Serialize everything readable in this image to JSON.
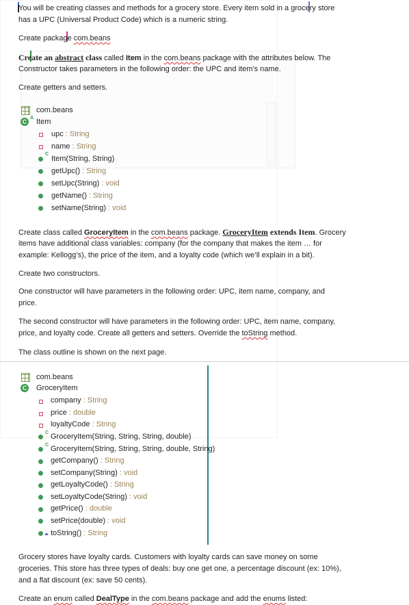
{
  "p1": {
    "l1": "You will be creating classes and methods for a grocery store. Every item sold in a grocery store",
    "l2": "has a UPC (Universal Product Code) which is a numeric string."
  },
  "p2": {
    "a": "Create package ",
    "b": "com.beans"
  },
  "p3": {
    "a": "Create an ",
    "b": "abstract",
    "c": " class",
    "d": " called ",
    "e": "Item",
    "f": " in the ",
    "g": "com.beans",
    "h": " package with the attributes below. The",
    "l2": "Constructor takes parameters in the following order: the UPC and item’s name."
  },
  "p4": "Create getters and setters.",
  "tree1": {
    "package": "com.beans",
    "class": "Item",
    "class_modifier": "A",
    "fields": [
      {
        "name": "upc",
        "type": " : String"
      },
      {
        "name": "name",
        "type": " : String"
      }
    ],
    "methods": [
      {
        "name": "Item(String, String)",
        "type": "",
        "badge": "C"
      },
      {
        "name": "getUpc()",
        "type": " : String"
      },
      {
        "name": "setUpc(String)",
        "type": " : void"
      },
      {
        "name": "getName()",
        "type": " : String"
      },
      {
        "name": "setName(String)",
        "type": " : void"
      }
    ]
  },
  "p5": {
    "a": "Create class called ",
    "b": "GroceryItem",
    "c": " in the ",
    "d": "com.beans",
    "e": " package. ",
    "f": "GroceryItem",
    "g": " extends Item",
    "h": ". Grocery",
    "l2": "items have additional class variables: company (for the company that makes the item … for",
    "l3": "example: Kellogg’s), the price of the item, and a loyalty code (which we’ll explain in a bit)."
  },
  "p6": "Create two constructors.",
  "p7": {
    "l1": "One constructor will have parameters in the following order: UPC, item name, company, and",
    "l2": "price."
  },
  "p8": {
    "l1": "The second constructor will have parameters in the following order:  UPC, item name, company,",
    "l2a": "price, and loyalty code. Create all getters and setters. Override the ",
    "l2b": "toString",
    "l2c": " method."
  },
  "p9": "The class outline is shown on the next page.",
  "tree2": {
    "package": "com.beans",
    "class": "GroceryItem",
    "fields": [
      {
        "name": "company",
        "type": " : String"
      },
      {
        "name": "price",
        "type": " : double"
      },
      {
        "name": "loyaltyCode",
        "type": " : String"
      }
    ],
    "methods": [
      {
        "name": "GroceryItem(String, String, String, double)",
        "type": "",
        "badge": "C"
      },
      {
        "name": "GroceryItem(String, String, String, double, String)",
        "type": "",
        "badge": "C"
      },
      {
        "name": "getCompany()",
        "type": " : String"
      },
      {
        "name": "setCompany(String)",
        "type": " : void"
      },
      {
        "name": "getLoyaltyCode()",
        "type": " : String"
      },
      {
        "name": "setLoyaltyCode(String)",
        "type": " : void"
      },
      {
        "name": "getPrice()",
        "type": " : double"
      },
      {
        "name": "setPrice(double)",
        "type": " : void"
      },
      {
        "name": "toString()",
        "type": " : String",
        "badge": "override"
      }
    ]
  },
  "p10": {
    "l1": "Grocery stores have loyalty cards. Customers with loyalty cards can save money on some",
    "l2": "groceries. This store has three types of deals: buy one get one, a percentage discount (ex: 10%),",
    "l3": "and a flat discount (ex: save 50 cents)."
  },
  "p11": {
    "a": "Create an ",
    "b": "enum",
    "c": " called ",
    "d": "DealType",
    "e": " in the ",
    "f": "com.beans",
    "g": " package and add the ",
    "h": "enums",
    "i": " listed:"
  },
  "colors": {
    "type_text": "#9b8258",
    "method_dot": "#3f9a55",
    "field_marker": "#d2425c",
    "class_icon": "#3c9a4c",
    "divider": "#cfcfcf",
    "cursor_teal": "#1a8a8a"
  }
}
